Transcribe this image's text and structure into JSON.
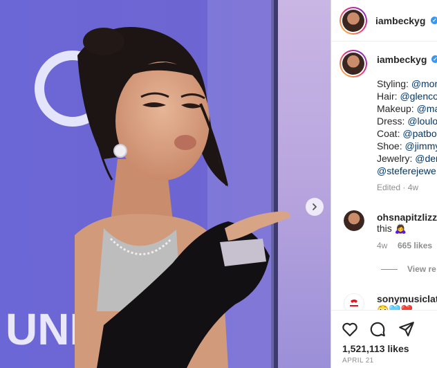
{
  "post": {
    "username": "iambeckyg",
    "verified_glyph": "✓",
    "next_icon": "chevron-right-icon",
    "caption_lines": [
      {
        "label": "Styling: ",
        "mention": "@mor"
      },
      {
        "label": "Hair: ",
        "mention": "@glenco"
      },
      {
        "label": "Makeup: ",
        "mention": "@ma"
      },
      {
        "label": "Dress: ",
        "mention": "@loulo"
      },
      {
        "label": "Coat: ",
        "mention": "@patbo"
      },
      {
        "label": "Shoe: ",
        "mention": "@jimmy"
      },
      {
        "label": "Jewelry: ",
        "mention": "@der"
      },
      {
        "label": "",
        "mention": "@steferejewe"
      }
    ],
    "edited": "Edited · 4w"
  },
  "comments": [
    {
      "user": "ohsnapitzlizz",
      "text": "this 🙇‍♀️",
      "age": "4w",
      "likes": "665 likes",
      "view_replies": "View re"
    },
    {
      "user": "sonymusiclat",
      "text": "😳🩵❤️"
    }
  ],
  "actions": {
    "like_icon": "heart-icon",
    "comment_icon": "comment-icon",
    "share_icon": "share-icon"
  },
  "stats": {
    "likes": "1,521,113 likes",
    "date": "APRIL 21"
  },
  "photo": {
    "backdrop_text": "UNIM",
    "colors": {
      "backdrop": "#6f6ad8",
      "hair": "#1d1513",
      "skin": "#d9a486",
      "coat": "#121012"
    }
  }
}
